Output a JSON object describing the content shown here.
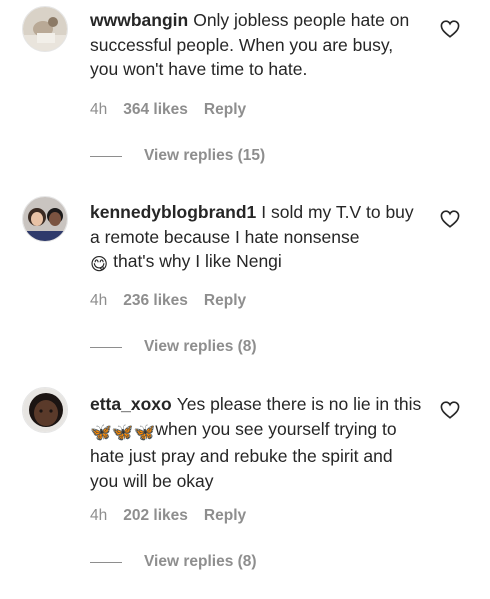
{
  "comments": [
    {
      "username": "wwwbangin",
      "text": "Only jobless people hate on successful people. When you are busy, you won't have time to hate.",
      "time": "4h",
      "likes": "364 likes",
      "reply": "Reply",
      "view_replies": "View replies (15)",
      "avatar_icon": "user-avatar-photo"
    },
    {
      "username": "kennedyblogbrand1",
      "text_before": "I sold my T.V to buy a remote because I hate nonsense",
      "emoji": "😋",
      "text_after": " that's why I like Nengi",
      "time": "4h",
      "likes": "236 likes",
      "reply": "Reply",
      "view_replies": "View replies (8)",
      "avatar_icon": "user-avatar-photo"
    },
    {
      "username": "etta_xoxo",
      "text_before": "Yes please there is no lie in this",
      "emoji": "🦋🦋🦋",
      "text_after": "when you see yourself trying to hate just pray and rebuke the spirit and you will be okay",
      "time": "4h",
      "likes": "202 likes",
      "reply": "Reply",
      "view_replies": "View replies (8)",
      "avatar_icon": "user-avatar-photo"
    }
  ],
  "icons": {
    "like": "heart-outline-icon"
  },
  "colors": {
    "text": "#262626",
    "secondary": "#8e8e8e"
  }
}
